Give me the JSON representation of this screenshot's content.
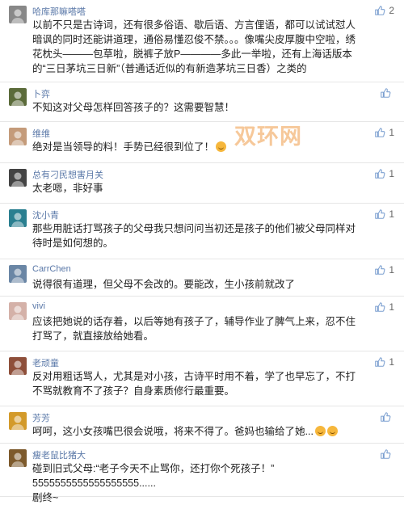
{
  "watermark": "双环网",
  "comments": [
    {
      "user": "哈库那嘛嗒嗒",
      "likes": "2",
      "text": "以前不只是古诗词，还有很多俗语、歇后语、方言俚语，都可以试试怼人暗讽的同时还能讲道理，通俗易懂忍俊不禁。。。像嘴尖皮厚腹中空啦，绣花枕头———包草啦，脱裤子放P————多此一举啦，还有上海话版本的“三日茅坑三日新”（普通话近似的有新造茅坑三日香）之类的"
    },
    {
      "user": "卜弈",
      "likes": "",
      "text": "不知这对父母怎样回答孩子的？这需要智慧！"
    },
    {
      "user": "维维",
      "likes": "1",
      "text": "绝对是当领导的料！手势已经很到位了！",
      "emoji": true
    },
    {
      "user": "总有刁民想害月关",
      "likes": "1",
      "text": "太老嗯，非好事"
    },
    {
      "user": "沈小青",
      "likes": "1",
      "text": "那些用脏话打骂孩子的父母我只想问问当初还是孩子的他们被父母同样对待时是如何想的。"
    },
    {
      "user": "CarrChen",
      "likes": "1",
      "text": "说得很有道理，但父母不会改的。要能改，生小孩前就改了"
    },
    {
      "user": "vivi",
      "likes": "1",
      "text": "应该把她说的话存着，以后等她有孩子了，辅导作业了脾气上来，忍不住打骂了，就直接放给她看。"
    },
    {
      "user": "老顽童",
      "likes": "1",
      "text": "反对用粗话骂人，尤其是对小孩，古诗平时用不着，学了也早忘了，不打不骂就教育不了孩子？自身素质修行最重要。"
    },
    {
      "user": "芳芳",
      "likes": "",
      "text": "呵呵，这小女孩嘴巴很会说哦，将来不得了。爸妈也输给了她...",
      "emoji2": true
    },
    {
      "user": "瘦老鼠比猪大",
      "likes": "",
      "text": "碰到旧式父母:“老子今天不止骂你，还打你个死孩子！”\n5555555555555555555......\n剧终~"
    }
  ],
  "colors": {
    "username": "#5a78a8",
    "like": "#7b9fd0",
    "watermark": "#f6c89a"
  }
}
